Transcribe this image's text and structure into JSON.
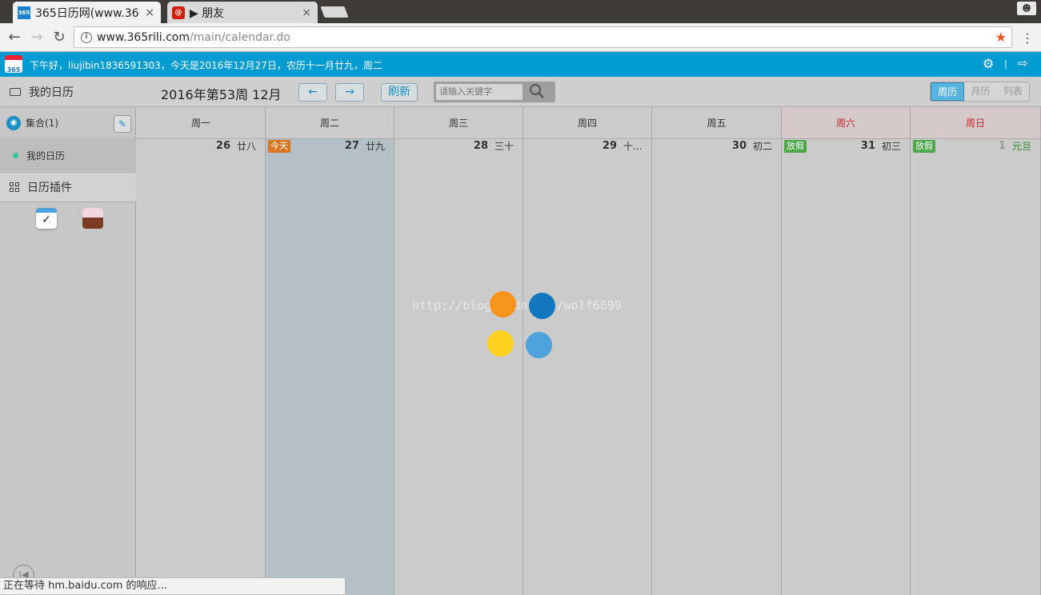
{
  "browser": {
    "tabs": [
      {
        "title": "365日历网(www.36",
        "favicon": "365-logo-icon",
        "active": true
      },
      {
        "title": "▶ 朋友",
        "favicon": "netease-music-icon",
        "active": false
      }
    ],
    "close_glyph": "×",
    "address": {
      "host": "www.365rili.com",
      "path": "/main/calendar.do"
    }
  },
  "topbar": {
    "logo_text": "365",
    "greeting": "下午好，liujibin1836591303，今天是2016年12月27日，农历十一月廿九，周二",
    "accent_color": "#009bd0"
  },
  "sidebar": {
    "my_calendar": "我的日历",
    "collection": "集合(1)",
    "sub_calendar": "我的日历",
    "plugins": "日历插件"
  },
  "header": {
    "week_title": "2016年第53周 12月",
    "prev": "←",
    "next": "→",
    "refresh": "刷新",
    "search_placeholder": "请输入关键字",
    "views": [
      "周历",
      "月历",
      "列表"
    ],
    "active_view": "周历"
  },
  "days": [
    {
      "name": "周一",
      "date": "26",
      "lunar": "廿八",
      "badge": "",
      "weekend": false,
      "today": false
    },
    {
      "name": "周二",
      "date": "27",
      "lunar": "廿九",
      "badge": "今天",
      "weekend": false,
      "today": true
    },
    {
      "name": "周三",
      "date": "28",
      "lunar": "三十",
      "badge": "",
      "weekend": false,
      "today": false
    },
    {
      "name": "周四",
      "date": "29",
      "lunar": "十...",
      "badge": "",
      "weekend": false,
      "today": false
    },
    {
      "name": "周五",
      "date": "30",
      "lunar": "初二",
      "badge": "",
      "weekend": false,
      "today": false
    },
    {
      "name": "周六",
      "date": "31",
      "lunar": "初三",
      "badge": "放假",
      "weekend": true,
      "today": false
    },
    {
      "name": "周日",
      "date": "1",
      "lunar": "元旦",
      "badge": "放假",
      "weekend": true,
      "today": false
    }
  ],
  "loader_colors": [
    "#f7941d",
    "#1377c0",
    "#ffd320",
    "#4ea2dc"
  ],
  "watermark": "http://blog.csdn.net/wolf6699",
  "status_text": "正在等待 hm.baidu.com 的响应..."
}
